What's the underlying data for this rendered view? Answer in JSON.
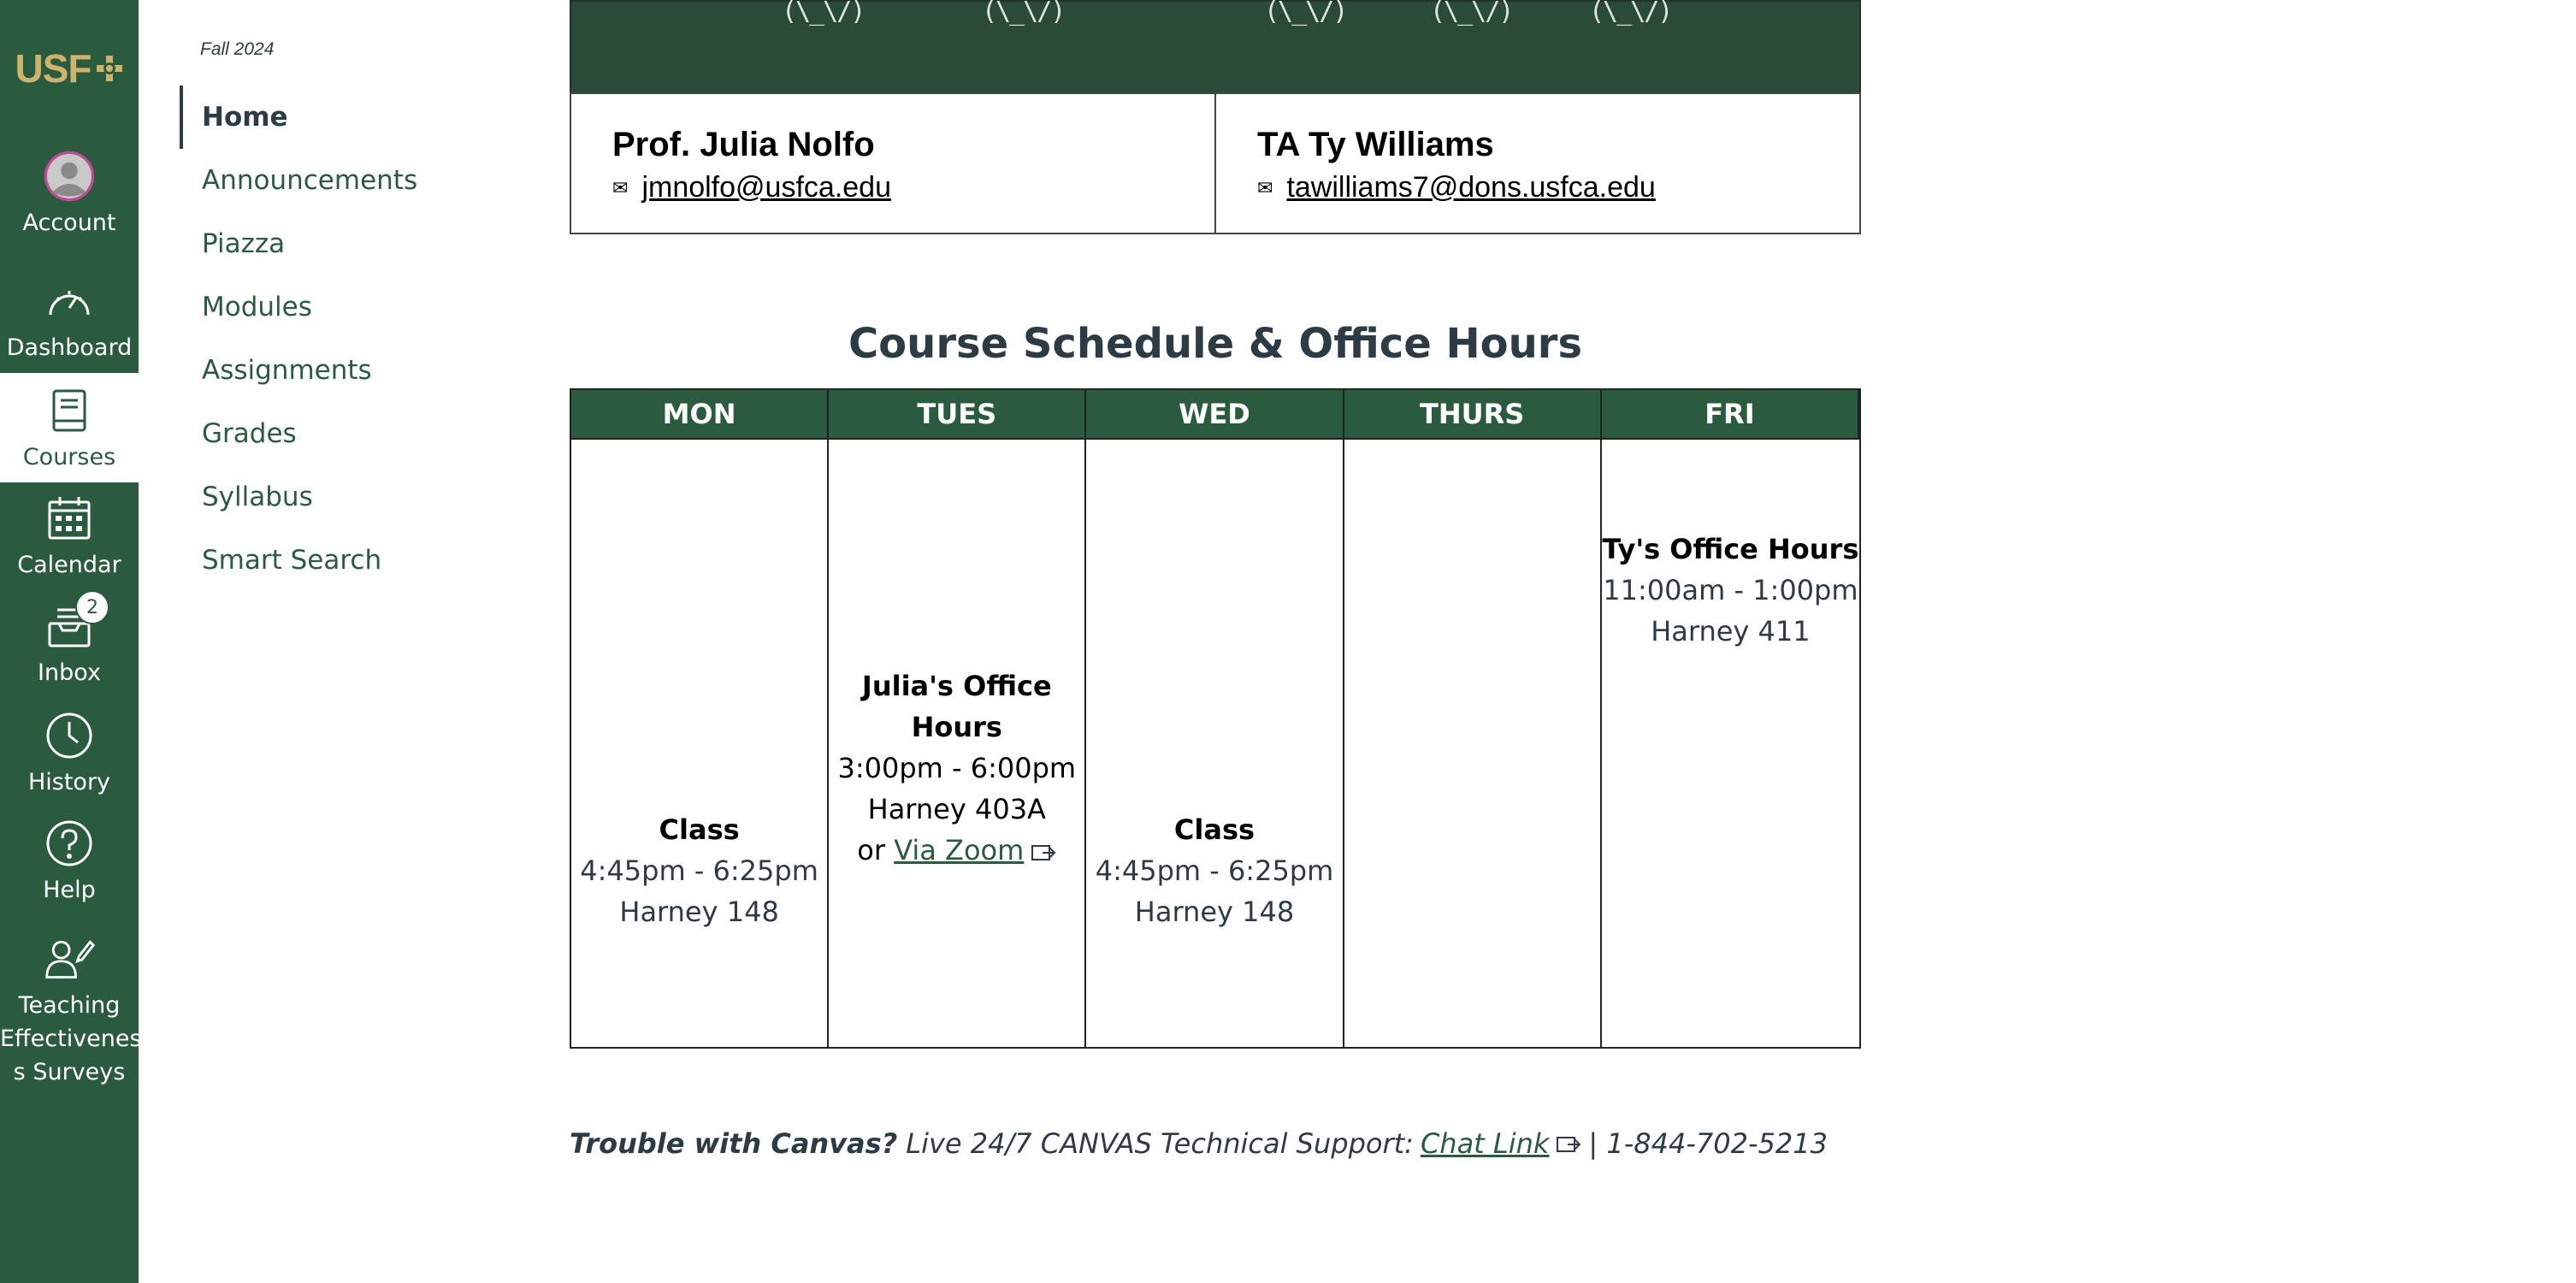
{
  "global_nav": {
    "logo_text": "USF",
    "items": [
      {
        "label": "Account",
        "icon": "account-avatar"
      },
      {
        "label": "Dashboard",
        "icon": "dashboard-icon"
      },
      {
        "label": "Courses",
        "icon": "courses-icon"
      },
      {
        "label": "Calendar",
        "icon": "calendar-icon"
      },
      {
        "label": "Inbox",
        "icon": "inbox-icon",
        "badge": "2"
      },
      {
        "label": "History",
        "icon": "history-icon"
      },
      {
        "label": "Help",
        "icon": "help-icon"
      },
      {
        "label": "Teaching Effectivenes s Surveys",
        "icon": "surveys-icon"
      }
    ],
    "active": "Courses"
  },
  "course_nav": {
    "term": "Fall 2024",
    "items": [
      "Home",
      "Announcements",
      "Piazza",
      "Modules",
      "Assignments",
      "Grades",
      "Syllabus",
      "Smart Search"
    ],
    "active": "Home"
  },
  "banner": {
    "art": "(\\_\\/)"
  },
  "contacts": [
    {
      "name": "Prof. Julia Nolfo",
      "email": "jmnolfo@usfca.edu"
    },
    {
      "name": "TA Ty Williams",
      "email": "tawilliams7@dons.usfca.edu"
    }
  ],
  "schedule": {
    "title": "Course Schedule & Office Hours",
    "days": [
      "MON",
      "TUES",
      "WED",
      "THURS",
      "FRI"
    ],
    "mon": {
      "title": "Class",
      "time": "4:45pm - 6:25pm",
      "room": "Harney 148"
    },
    "tues": {
      "title": "Julia's Office Hours",
      "time": "3:00pm - 6:00pm",
      "room": "Harney 403A",
      "or_text": "or",
      "link": "Via Zoom"
    },
    "wed": {
      "title": "Class",
      "time": "4:45pm - 6:25pm",
      "room": "Harney 148"
    },
    "fri": {
      "title": "Ty's Office Hours",
      "time": "11:00am - 1:00pm",
      "room": "Harney 411"
    }
  },
  "support": {
    "lead": "Trouble with Canvas?",
    "text": "Live 24/7 CANVAS Technical Support:",
    "link": "Chat Link",
    "phone": "| 1-844-702-5213"
  },
  "colors": {
    "usf_green": "#2b5b3f",
    "usf_gold": "#cfb26b",
    "text": "#2d3b45"
  }
}
